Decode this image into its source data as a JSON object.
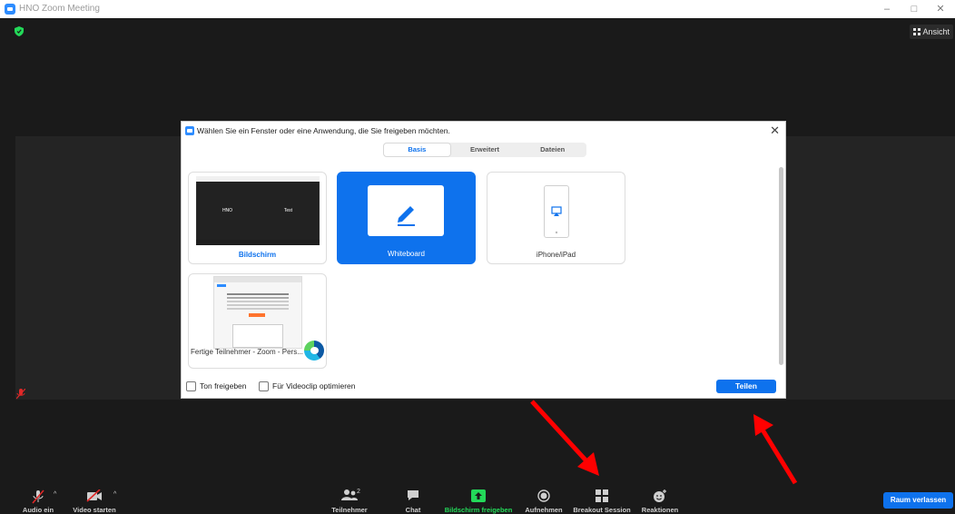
{
  "window": {
    "title": "HNO  Zoom Meeting",
    "minimize": "–",
    "maximize": "□",
    "close": "✕"
  },
  "meeting": {
    "view_label": "Ansicht"
  },
  "dialog": {
    "title": "Wählen Sie ein Fenster oder eine Anwendung, die Sie freigeben möchten.",
    "close": "✕",
    "tabs": [
      {
        "label": "Basis",
        "active": true
      },
      {
        "label": "Erweitert",
        "active": false
      },
      {
        "label": "Dateien",
        "active": false
      }
    ],
    "tiles": [
      {
        "label": "Bildschirm",
        "thumb_left": "HNO",
        "thumb_right": "Test"
      },
      {
        "label": "Whiteboard",
        "selected": true
      },
      {
        "label": "iPhone/iPad"
      },
      {
        "label": "Fertige Teilnehmer - Zoom - Pers..."
      }
    ],
    "share_audio": "Ton freigeben",
    "optimize_video": "Für Videoclip optimieren",
    "share_button": "Teilen"
  },
  "toolbar": {
    "audio": "Audio ein",
    "video": "Video starten",
    "participants": "Teilnehmer",
    "participants_count": "2",
    "chat": "Chat",
    "share_screen": "Bildschirm freigeben",
    "record": "Aufnehmen",
    "breakout": "Breakout Session",
    "reactions": "Reaktionen",
    "leave": "Raum verlassen"
  },
  "colors": {
    "accent": "#0e72ed",
    "share_green": "#23d959",
    "annotation_red": "#ff0000"
  }
}
